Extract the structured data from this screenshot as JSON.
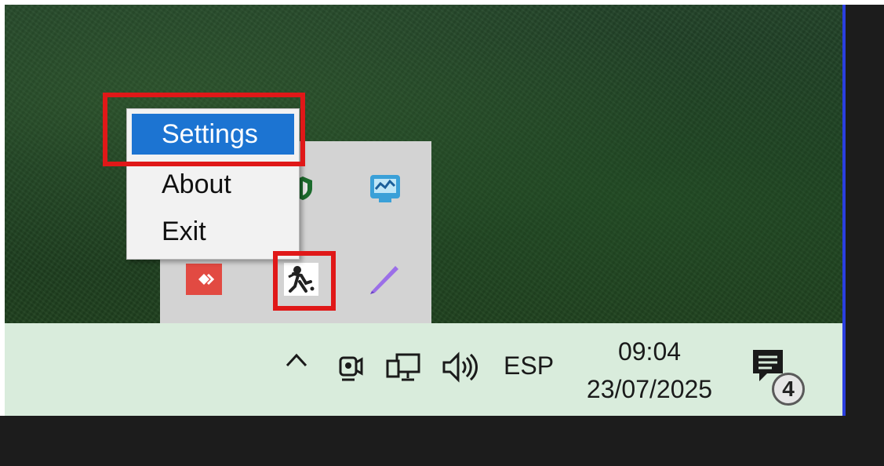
{
  "context_menu": {
    "items": [
      {
        "label": "Settings",
        "selected": true
      },
      {
        "label": "About"
      },
      {
        "label": "Exit"
      }
    ]
  },
  "tray_overflow": {
    "icons": [
      "shield-icon",
      "monitor-app-icon",
      "anydesk-icon",
      "fighter-app-icon",
      "pen-icon"
    ]
  },
  "taskbar": {
    "chevron": "^",
    "language": "ESP",
    "time": "09:04",
    "date": "23/07/2025",
    "notification_count": "4"
  },
  "colors": {
    "menu_highlight": "#1c74d2",
    "annotation_red": "#e01818",
    "taskbar_bg": "#d9ecdc",
    "accent_edge": "#2a3fe0"
  }
}
